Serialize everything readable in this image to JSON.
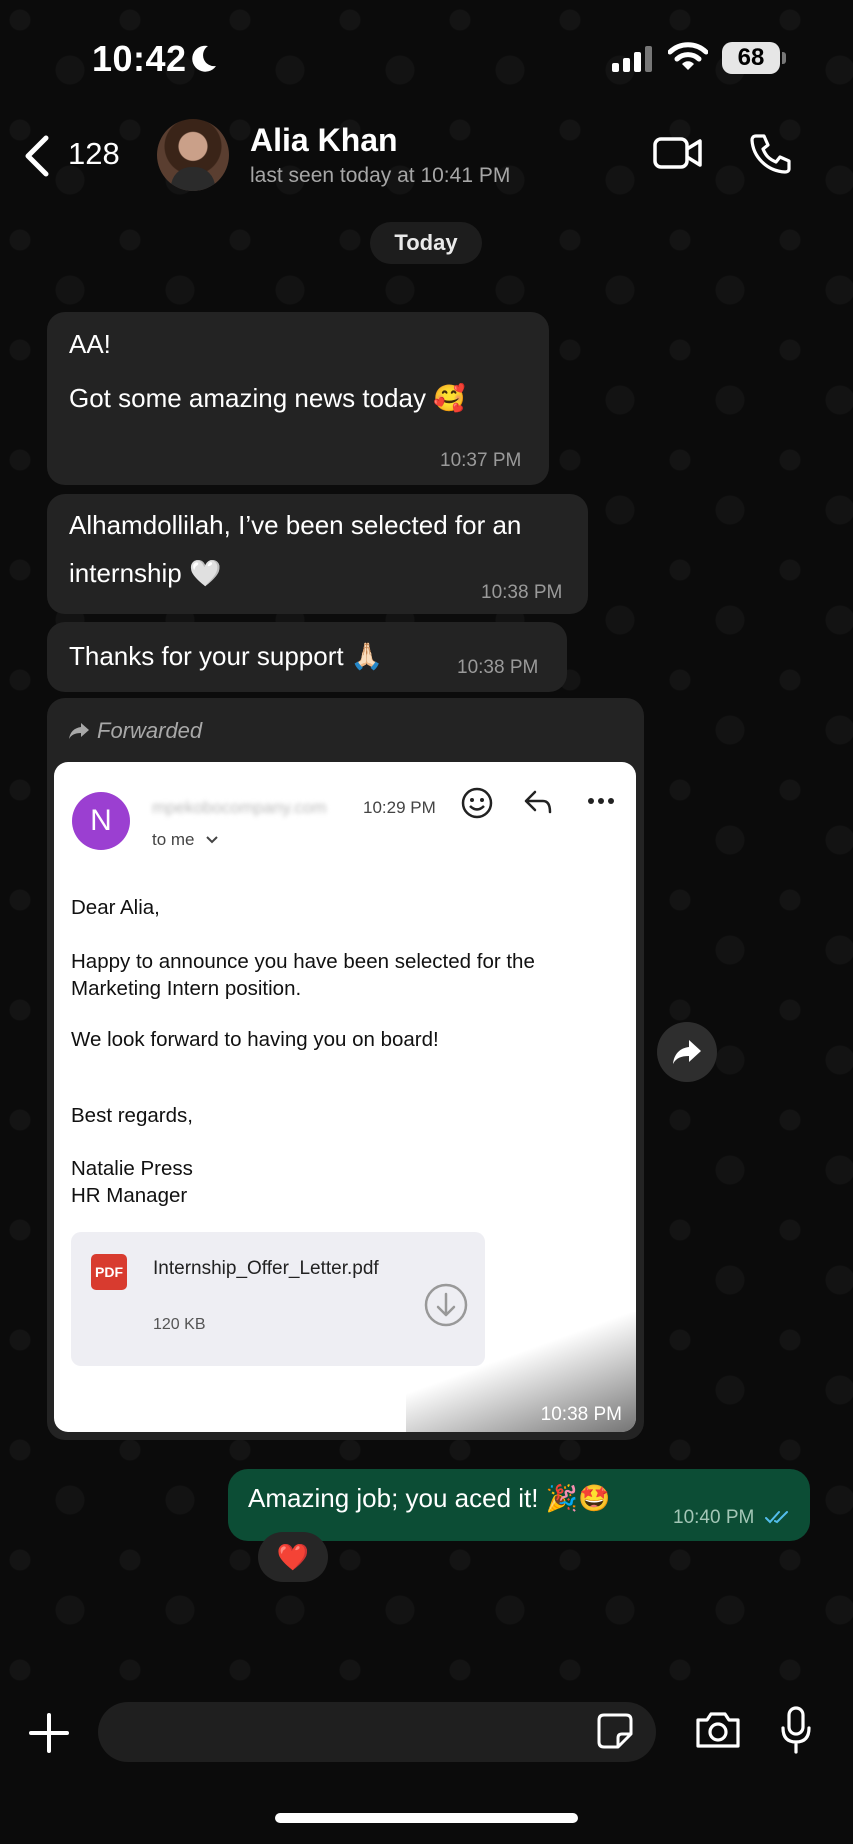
{
  "status_bar": {
    "time": "10:42",
    "battery": "68"
  },
  "header": {
    "back_count": "128",
    "contact_name": "Alia Khan",
    "last_seen": "last seen today at 10:41 PM"
  },
  "date_divider": "Today",
  "messages": [
    {
      "lines": [
        "AA!",
        "Got some amazing news today 🥰"
      ],
      "time": "10:37 PM"
    },
    {
      "lines": [
        "Alhamdollilah, I’ve been selected for an",
        "internship 🤍"
      ],
      "time": "10:38 PM"
    },
    {
      "lines": [
        "Thanks for your support 🙏🏻"
      ],
      "time": "10:38 PM"
    }
  ],
  "forwarded": {
    "label": "Forwarded",
    "time": "10:38 PM",
    "email": {
      "avatar_letter": "N",
      "sender": "mpekobocompany.com",
      "time": "10:29 PM",
      "to": "to me",
      "greeting": "Dear Alia,",
      "paragraph1": "Happy to announce you have been selected for the Marketing Intern position.",
      "paragraph2": "We look forward to having you on board!",
      "signoff": "Best regards,",
      "sig_name": "Natalie Press",
      "sig_title": "HR Manager",
      "attachment": {
        "badge": "PDF",
        "name": "Internship_Offer_Letter.pdf",
        "size": "120 KB"
      }
    }
  },
  "outgoing": {
    "text": "Amazing job; you aced it! 🎉🤩",
    "time": "10:40 PM",
    "reaction": "❤️"
  },
  "colors": {
    "incoming_bubble": "#232323",
    "outgoing_bubble": "#0c4d35",
    "read_ticks": "#53bdeb",
    "avatar_purple": "#9b3fd1"
  }
}
